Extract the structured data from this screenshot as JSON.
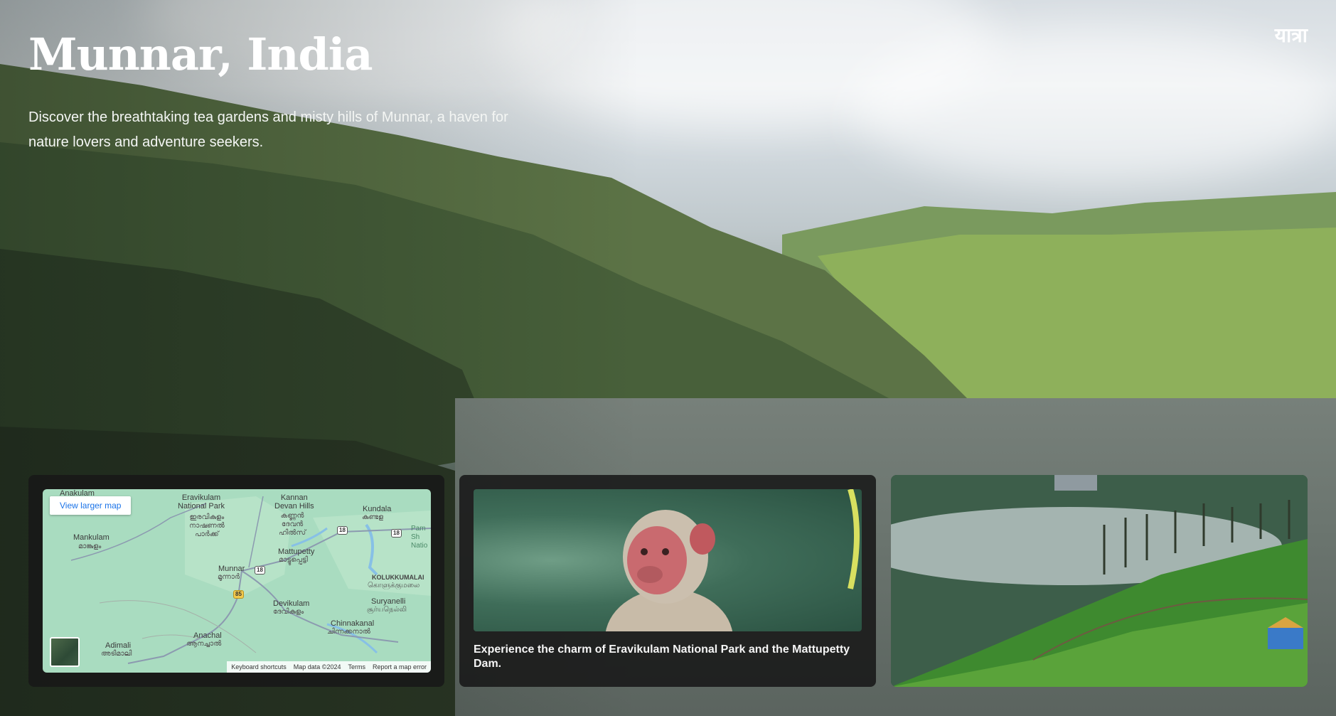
{
  "brand": "यात्रा",
  "hero": {
    "title": "Munnar, India",
    "description": "Discover the breathtaking tea gardens and misty hills of Munnar, a haven for nature lovers and adventure seekers."
  },
  "map": {
    "view_larger_label": "View larger map",
    "labels": {
      "anakulam": "Anakulam",
      "eravikulam": "Eravikulam\nNational Park",
      "eravikulam_ml": "ഇരവികുളം\nനാഷണൽ\nപാർക്ക്",
      "kannan": "Kannan\nDevan Hills",
      "kannan_ml": "കണ്ണൻ\nദേവൻ\nഹിൽസ്",
      "kundala": "Kundala",
      "kundala_ml": "കുണ്ടള",
      "mankulam": "Mankulam",
      "mankulam_ml": "മാങ്കുളം",
      "mattupetty": "Mattupetty",
      "mattupetty_ml": "മാട്ടുപ്പെട്ടി",
      "munnar": "Munnar",
      "munnar_ml": "മൂന്നാർ",
      "devikulam": "Devikulam",
      "devikulam_ml": "ദേവികുളം",
      "kolukkumalai": "KOLUKKUMALAI",
      "kolukkumalai_ta": "கொளுக்குமலை",
      "suryanelli": "Suryanelli",
      "suryanelli_ta": "சூர்யநெல்லி",
      "chinnakanal": "Chinnakanal",
      "chinnakanal_ml": "ചിന്നക്കനാൽ",
      "anachal": "Anachal",
      "anachal_ml": "ആനച്ചാൽ",
      "adimali": "Adimali",
      "adimali_ml": "അടിമാലി",
      "pambadum": "Pam\nSh\nNatio"
    },
    "shields": {
      "r18a": "18",
      "r18b": "18",
      "r18c": "18",
      "r85": "85"
    },
    "footer": {
      "shortcuts": "Keyboard shortcuts",
      "data": "Map data ©2024",
      "terms": "Terms",
      "report": "Report a map error"
    }
  },
  "info_card": {
    "caption": "Experience the charm of Eravikulam National Park and the Mattupetty Dam."
  }
}
